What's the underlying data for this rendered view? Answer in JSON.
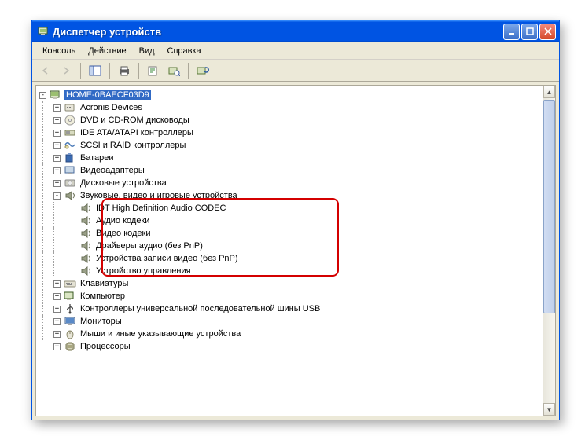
{
  "window": {
    "title": "Диспетчер устройств"
  },
  "menu": {
    "console": "Консоль",
    "action": "Действие",
    "view": "Вид",
    "help": "Справка"
  },
  "tree": {
    "root": "HOME-0BAECF03D9",
    "nodes": {
      "n0": "Acronis Devices",
      "n1": "DVD и CD-ROM дисководы",
      "n2": "IDE ATA/ATAPI контроллеры",
      "n3": "SCSI и RAID контроллеры",
      "n4": "Батареи",
      "n5": "Видеоадаптеры",
      "n6": "Дисковые устройства",
      "n7": "Звуковые, видео и игровые устройства",
      "n7_0": "IDT High Definition Audio CODEC",
      "n7_1": "Аудио кодеки",
      "n7_2": "Видео кодеки",
      "n7_3": "Драйверы аудио (без PnP)",
      "n7_4": "Устройства записи видео (без PnP)",
      "n7_5": "Устройство управления",
      "n8": "Клавиатуры",
      "n9": "Компьютер",
      "n10": "Контроллеры универсальной последовательной шины USB",
      "n11": "Мониторы",
      "n12": "Мыши и иные указывающие устройства",
      "n13": "Процессоры"
    }
  }
}
